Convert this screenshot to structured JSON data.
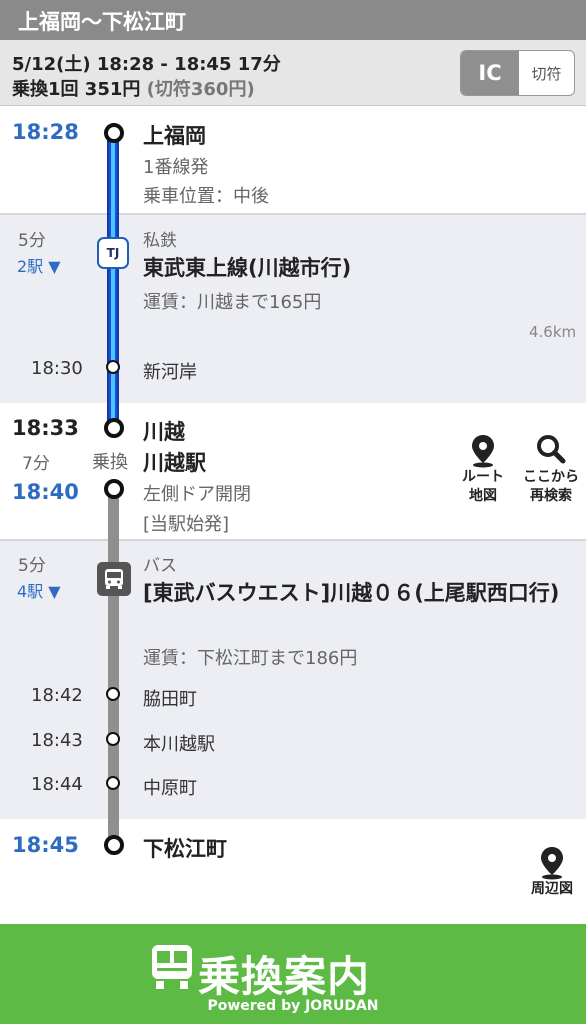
{
  "header": {
    "title": "上福岡〜下松江町"
  },
  "summary": {
    "datetime": "5/12(土) 18:28 - 18:45 17分",
    "fare": "乗換1回 351円",
    "ticket_fare": "(切符360円)",
    "toggle": {
      "ic": "IC",
      "kippu": "切符",
      "selected": "IC"
    }
  },
  "route": {
    "origin": {
      "time": "18:28",
      "station": "上福岡",
      "platform": "1番線発",
      "position": "乗車位置：中後"
    },
    "leg1": {
      "duration": "5分",
      "stops": "2駅 ▼",
      "badge": "TJ",
      "type": "私鉄",
      "line": "東武東上線(川越市行)",
      "fare": "運賃：川越まで165円",
      "distance": "4.6km",
      "intermediate": [
        {
          "time": "18:30",
          "name": "新河岸"
        }
      ]
    },
    "transfer": {
      "arrive_time": "18:33",
      "wait": "7分",
      "label": "乗換",
      "station": "川越",
      "station_next": "川越駅",
      "depart_time": "18:40",
      "door": "左側ドア開閉",
      "note": "[当駅始発]",
      "actions": [
        {
          "icon": "map-pin-icon",
          "line1": "ルート",
          "line2": "地図"
        },
        {
          "icon": "search-icon",
          "line1": "ここから",
          "line2": "再検索"
        }
      ]
    },
    "leg2": {
      "duration": "5分",
      "stops": "4駅 ▼",
      "badge": "bus-icon",
      "type": "バス",
      "line": "[東武バスウエスト]川越０６(上尾駅西口行)",
      "fare": "運賃：下松江町まで186円",
      "intermediate": [
        {
          "time": "18:42",
          "name": "脇田町"
        },
        {
          "time": "18:43",
          "name": "本川越駅"
        },
        {
          "time": "18:44",
          "name": "中原町"
        }
      ]
    },
    "destination": {
      "time": "18:45",
      "station": "下松江町",
      "action": {
        "icon": "map-pin-icon",
        "label": "周辺図"
      }
    }
  },
  "footer": {
    "logo": "乗換案内",
    "powered": "Powered by JORUDAN"
  },
  "colors": {
    "accent_blue": "#2e6cc4",
    "rail_blue": "#1f4fd8",
    "rail_light": "#48c6ff",
    "rail_gray": "#8f8f8f",
    "footer_green": "#5cba45",
    "section_gray": "#eceef4"
  }
}
